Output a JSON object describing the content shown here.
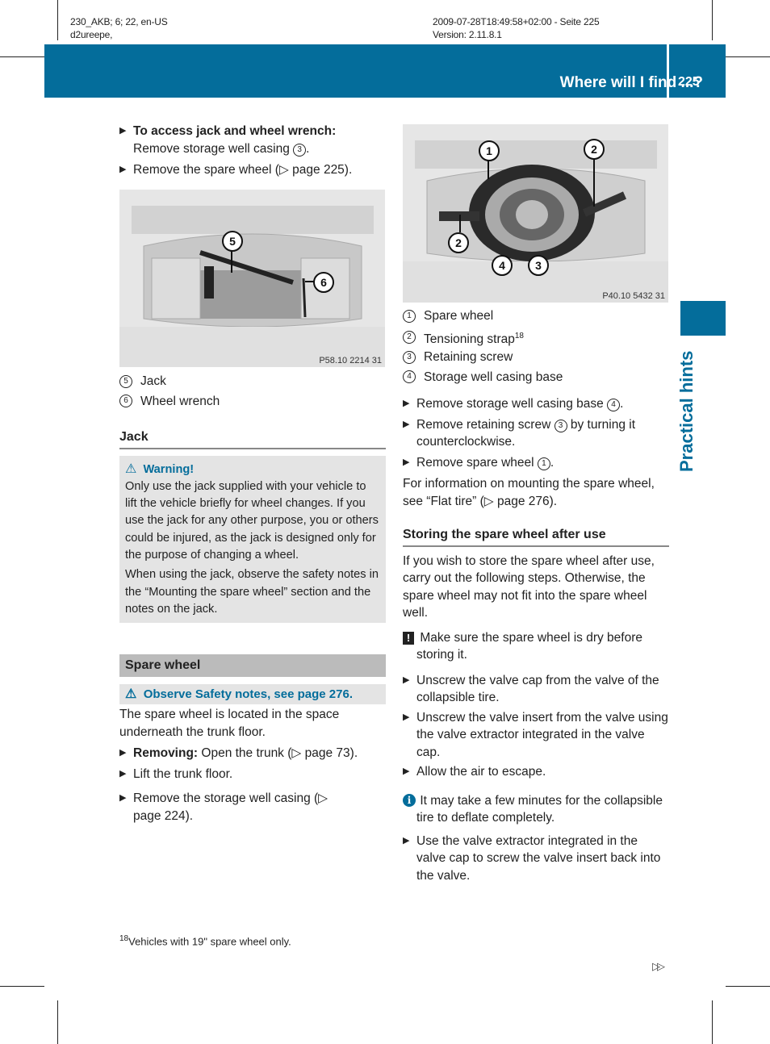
{
  "meta": {
    "left_line1": "230_AKB; 6; 22, en-US",
    "left_line2": "d2ureepe,",
    "right_line1": "2009-07-28T18:49:58+02:00 - Seite 225",
    "right_line2": "Version: 2.11.8.1"
  },
  "header": {
    "title": "Where will I find ...?",
    "page_number": "225"
  },
  "side_tab": {
    "label": "Practical hints"
  },
  "colors": {
    "brand_blue": "#046d9b",
    "box_gray": "#e4e4e4",
    "heading_gray": "#bbbbbb"
  },
  "left": {
    "step1_bold": "To access jack and wheel wrench:",
    "step1_text": "Remove storage well casing",
    "step1_ref": "3",
    "step2_text": "Remove the spare wheel (",
    "step2_page": "page 225).",
    "photo1": {
      "code": "P58.10 2214 31",
      "callouts": [
        "5",
        "6"
      ]
    },
    "legend": [
      {
        "num": "5",
        "label": "Jack"
      },
      {
        "num": "6",
        "label": "Wheel wrench"
      }
    ],
    "jack_heading": "Jack",
    "warning": {
      "title": "Warning!",
      "para1": "Only use the jack supplied with your vehicle to lift the vehicle briefly for wheel changes. If you use the jack for any other purpose, you or others could be injured, as the jack is designed only for the purpose of changing a wheel.",
      "para2": "When using the jack, observe the safety notes in the “Mounting the spare wheel” section and the notes on the jack."
    },
    "spare_heading": "Spare wheel",
    "safety_note": "Observe Safety notes, see page 276.",
    "spare_intro": "The spare wheel is located in the space underneath the trunk floor.",
    "steps": [
      {
        "bold": "Removing:",
        "text": " Open the trunk (▷ page 73)."
      },
      {
        "bold": "",
        "text": "Lift the trunk floor."
      },
      {
        "bold": "",
        "text": "Remove the storage well casing (▷ page 224)."
      }
    ]
  },
  "right": {
    "photo2": {
      "code": "P40.10 5432 31",
      "callouts": [
        "1",
        "2",
        "2",
        "4",
        "3"
      ]
    },
    "legend": [
      {
        "num": "1",
        "label": "Spare wheel",
        "sup": ""
      },
      {
        "num": "2",
        "label": "Tensioning strap",
        "sup": "18"
      },
      {
        "num": "3",
        "label": "Retaining screw",
        "sup": ""
      },
      {
        "num": "4",
        "label": "Storage well casing base",
        "sup": ""
      }
    ],
    "steps_a": [
      {
        "text": "Remove storage well casing base ",
        "ref": "4",
        "after": "."
      },
      {
        "text": "Remove retaining screw ",
        "ref": "3",
        "after": " by turning it counterclockwise."
      },
      {
        "text": "Remove spare wheel ",
        "ref": "1",
        "after": "."
      }
    ],
    "mounting_info": "For information on mounting the spare wheel, see “Flat tire” (▷ page 276).",
    "storing_heading": "Storing the spare wheel after use",
    "storing_intro": "If you wish to store the spare wheel after use, carry out the following steps. Otherwise, the spare wheel may not fit into the spare wheel well.",
    "caution": "Make sure the spare wheel is dry before storing it.",
    "steps_b": [
      "Unscrew the valve cap from the valve of the collapsible tire.",
      "Unscrew the valve insert from the valve using the valve extractor integrated in the valve cap.",
      "Allow the air to escape."
    ],
    "info": "It may take a few minutes for the collapsible tire to deflate completely.",
    "step_c": "Use the valve extractor integrated in the valve cap to screw the valve insert back into the valve."
  },
  "footnote": {
    "num": "18",
    "text": "Vehicles with 19\" spare wheel only."
  },
  "continue_marker": "▷▷"
}
